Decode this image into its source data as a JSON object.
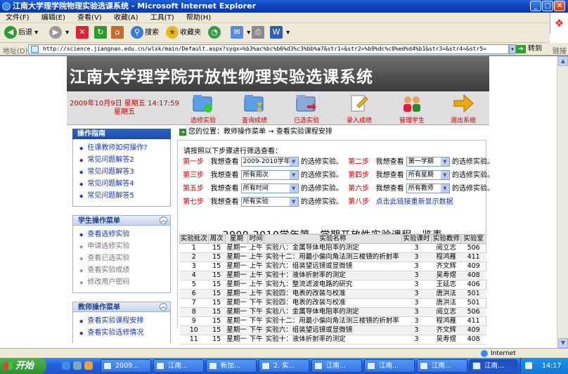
{
  "window": {
    "title": "江南大学理学院物理实验选课系统 - Microsoft Internet Explorer"
  },
  "menu": [
    "文件(F)",
    "编辑(E)",
    "查看(V)",
    "收藏(A)",
    "工具(T)",
    "帮助(H)"
  ],
  "toolbar": {
    "back": "后退",
    "search": "搜索",
    "favorites": "收藏夹"
  },
  "address": {
    "label": "地址(D)",
    "url": "http://science.jiangnan.edu.cn/wlxk/main/Default.aspx?syqx=%b3%ac%bc%b6%d3%c3%bb%a7&str1=&str2=%b9%dc%c0%ed%d4%b1&str3=&str4=&str5=",
    "go": "转到",
    "links": "链接"
  },
  "banner": {
    "title": "江南大学理学院开放性物理实验选课系统"
  },
  "header": {
    "date": "2009年10月9日 星期五 14:17:59",
    "weekday": "星期五"
  },
  "nav": [
    "选修实验",
    "查询成绩",
    "已选实验",
    "录入成绩",
    "管理学生",
    "退出系统"
  ],
  "guide": {
    "title": "操作指南",
    "items": [
      "任课教师如何操作?",
      "常见问题解答2",
      "常见问题解答3",
      "常见问题解答4",
      "常见问题解答5"
    ]
  },
  "student_menu": {
    "title": "学生操作菜单",
    "items": [
      "查看选修实验",
      "申请选修实验",
      "查看已选实验",
      "查看实验成绩",
      "修改用户密码"
    ]
  },
  "teacher_menu": {
    "title": "教师操作菜单",
    "items": [
      "查看实验课程安排",
      "查看实验选修情况"
    ]
  },
  "breadcrumb": "您的位置：教师操作菜单 → 查看实验课程安排",
  "filter": {
    "hint": "请按照以下步骤进行筛选查看：",
    "steps": [
      "第一步",
      "第二步",
      "第三步",
      "第四步",
      "第五步",
      "第六步",
      "第七步",
      "第八步"
    ],
    "want": "我想查看",
    "suffix": "的选修实验。",
    "selects": [
      "2009-2010学年",
      "第一学期",
      "所有周次",
      "所有星期",
      "所有时间",
      "所有教师",
      "所有实验"
    ],
    "refresh": "点击此链接重新显示数据"
  },
  "table": {
    "title": "2009-2010学年第一学期开放性实验课程一览表",
    "headers": [
      "实验批次",
      "周次",
      "星期",
      "时间",
      "实验名称",
      "实验课时",
      "实验教师",
      "实验室"
    ],
    "rows": [
      [
        "1",
        "15",
        "星期一",
        "上午",
        "实验八：金属导体电阻率的测定",
        "3",
        "阅立志",
        "506"
      ],
      [
        "2",
        "15",
        "星期一",
        "上午",
        "实验十二：用最小偏向角法测三棱镜的折射率",
        "3",
        "程鸿雁",
        "411"
      ],
      [
        "3",
        "15",
        "星期一",
        "上午",
        "实验六：组装望远镜或显微镜",
        "3",
        "齐文辉",
        "409"
      ],
      [
        "4",
        "15",
        "星期一",
        "上午",
        "实验十：液体折射率的测定",
        "3",
        "吴寿煜",
        "408"
      ],
      [
        "5",
        "15",
        "星期一",
        "上午",
        "实验九：整流滤波电路的研究",
        "3",
        "王延志",
        "406"
      ],
      [
        "6",
        "15",
        "星期一",
        "上午",
        "实验四：电表的改装与校准",
        "3",
        "唐洪法",
        "501"
      ],
      [
        "7",
        "15",
        "星期一",
        "下午",
        "实验四：电表的改装与校准",
        "3",
        "唐洪法",
        "501"
      ],
      [
        "8",
        "15",
        "星期一",
        "下午",
        "实验八：金属导体电阻率的测定",
        "3",
        "阅立志",
        "506"
      ],
      [
        "9",
        "15",
        "星期一",
        "下午",
        "实验十二：用最小偏向角法测三棱镜的折射率",
        "3",
        "程鸿雁",
        "411"
      ],
      [
        "10",
        "15",
        "星期一",
        "下午",
        "实验六：组装望远镜或显微镜",
        "3",
        "齐文辉",
        "409"
      ],
      [
        "11",
        "15",
        "星期一",
        "下午",
        "实验十：液体折射率的测定",
        "3",
        "吴寿煜",
        "408"
      ]
    ]
  },
  "status": {
    "zone": "Internet"
  },
  "taskbar": {
    "start": "开始",
    "tasks": [
      "2009...",
      "江南...",
      "新加...",
      "2. 实...",
      "江南...",
      "江南...",
      "江南...",
      "江南..."
    ],
    "clock": "14:17"
  }
}
